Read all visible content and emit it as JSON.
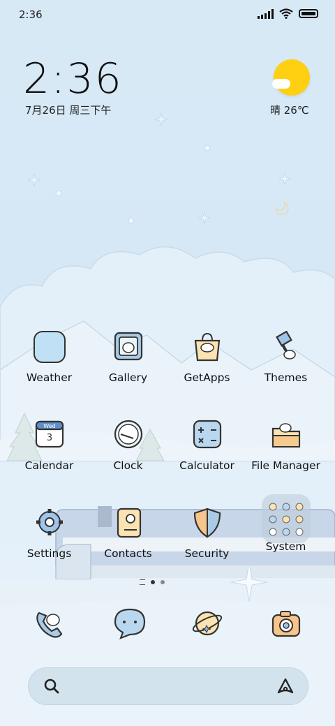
{
  "status_bar": {
    "time": "2:36"
  },
  "clock_widget": {
    "time": "2:36",
    "date": "7月26日 周三下午"
  },
  "weather_widget": {
    "temperature": "晴 26℃"
  },
  "apps": {
    "row1": [
      {
        "label": "Weather"
      },
      {
        "label": "Gallery"
      },
      {
        "label": "GetApps"
      },
      {
        "label": "Themes"
      }
    ],
    "row2": [
      {
        "label": "Calendar",
        "icon_text": "Wed",
        "icon_day": "3"
      },
      {
        "label": "Clock"
      },
      {
        "label": "Calculator"
      },
      {
        "label": "File Manager"
      }
    ],
    "row3": [
      {
        "label": "Settings"
      },
      {
        "label": "Contacts"
      },
      {
        "label": "Security"
      },
      {
        "label": "System"
      }
    ]
  },
  "dock": [
    "phone-icon",
    "messages-icon",
    "browser-icon",
    "camera-icon"
  ],
  "page_indicator": {
    "pages": 2,
    "current": 1
  },
  "search_bar": {
    "left_icon": "search-icon",
    "right_icon": "assistant-icon"
  },
  "colors": {
    "sky": "#d6e8f6",
    "sun": "#ffcf11",
    "icon_blue": "#bfe0f5",
    "icon_cream": "#fbe3b2"
  }
}
